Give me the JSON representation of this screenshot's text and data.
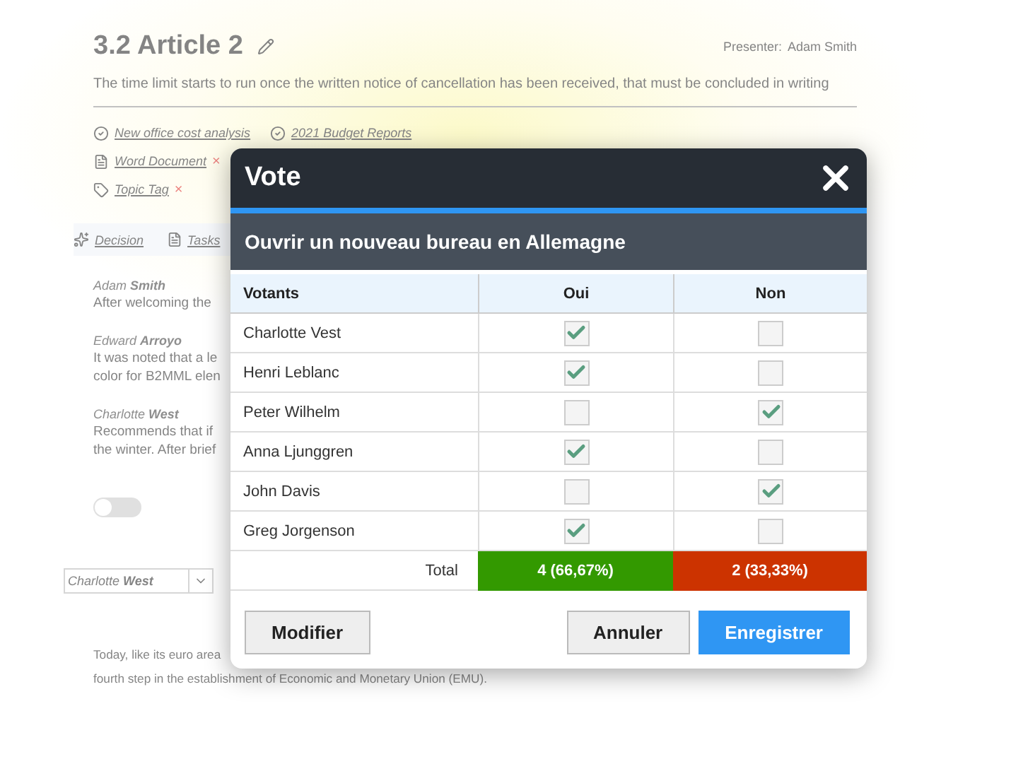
{
  "background": {
    "heading": "3.2 Article 2",
    "presenter_label": "Presenter:",
    "presenter": "Adam Smith",
    "description": "The time limit starts to run once the written notice of cancellation has been received, that must be concluded in writing",
    "links": [
      {
        "label": "New office cost analysis"
      },
      {
        "label": "2021 Budget Reports"
      }
    ],
    "attachments": [
      {
        "kind": "document",
        "label": "Word Document",
        "remove": "×"
      },
      {
        "kind": "tag",
        "label": "Topic Tag",
        "remove": "×"
      }
    ],
    "sections": [
      {
        "kind": "decision",
        "label": "Decision"
      },
      {
        "kind": "tasks",
        "label": "Tasks"
      }
    ],
    "comments": [
      {
        "author": "Adam **Smith**",
        "lines": [
          "After welcoming the"
        ]
      },
      {
        "author": "Edward **Arroyo**",
        "lines": [
          "It was noted that a le",
          "color for B2MML elen"
        ]
      },
      {
        "author": "Charlotte **West**",
        "lines": [
          "Recommends that if",
          "the winter. After brief"
        ]
      }
    ],
    "toggle": {
      "on": false
    },
    "dropdown": {
      "value": "Charlotte **West**"
    },
    "paragraph": [
      "Today, like its euro area",
      "fourth step in the establishment of Economic and Monetary Union (EMU)."
    ]
  },
  "dialog": {
    "title": "Vote",
    "question": "Ouvrir un nouveau bureau en Allemagne",
    "columns": [
      "Votants",
      "Oui",
      "Non"
    ],
    "rows": [
      {
        "name": "Charlotte Vest",
        "yes": true,
        "no": false
      },
      {
        "name": "Henri Leblanc",
        "yes": true,
        "no": false
      },
      {
        "name": "Peter Wilhelm",
        "yes": false,
        "no": true
      },
      {
        "name": "Anna Ljunggren",
        "yes": true,
        "no": false
      },
      {
        "name": "John Davis",
        "yes": false,
        "no": true
      },
      {
        "name": "Greg Jorgenson",
        "yes": true,
        "no": false
      }
    ],
    "total_label": "Total",
    "totals": [
      {
        "text": "4 (66,67%)",
        "color": "#339900"
      },
      {
        "text": "2 (33,33%)",
        "color": "#cc3300"
      }
    ],
    "left_buttons": [
      {
        "label": "Modifier",
        "kind": "secondary"
      }
    ],
    "right_buttons": [
      {
        "label": "Annuler",
        "kind": "secondary"
      },
      {
        "label": "Enregistrer",
        "kind": "primary"
      }
    ]
  }
}
